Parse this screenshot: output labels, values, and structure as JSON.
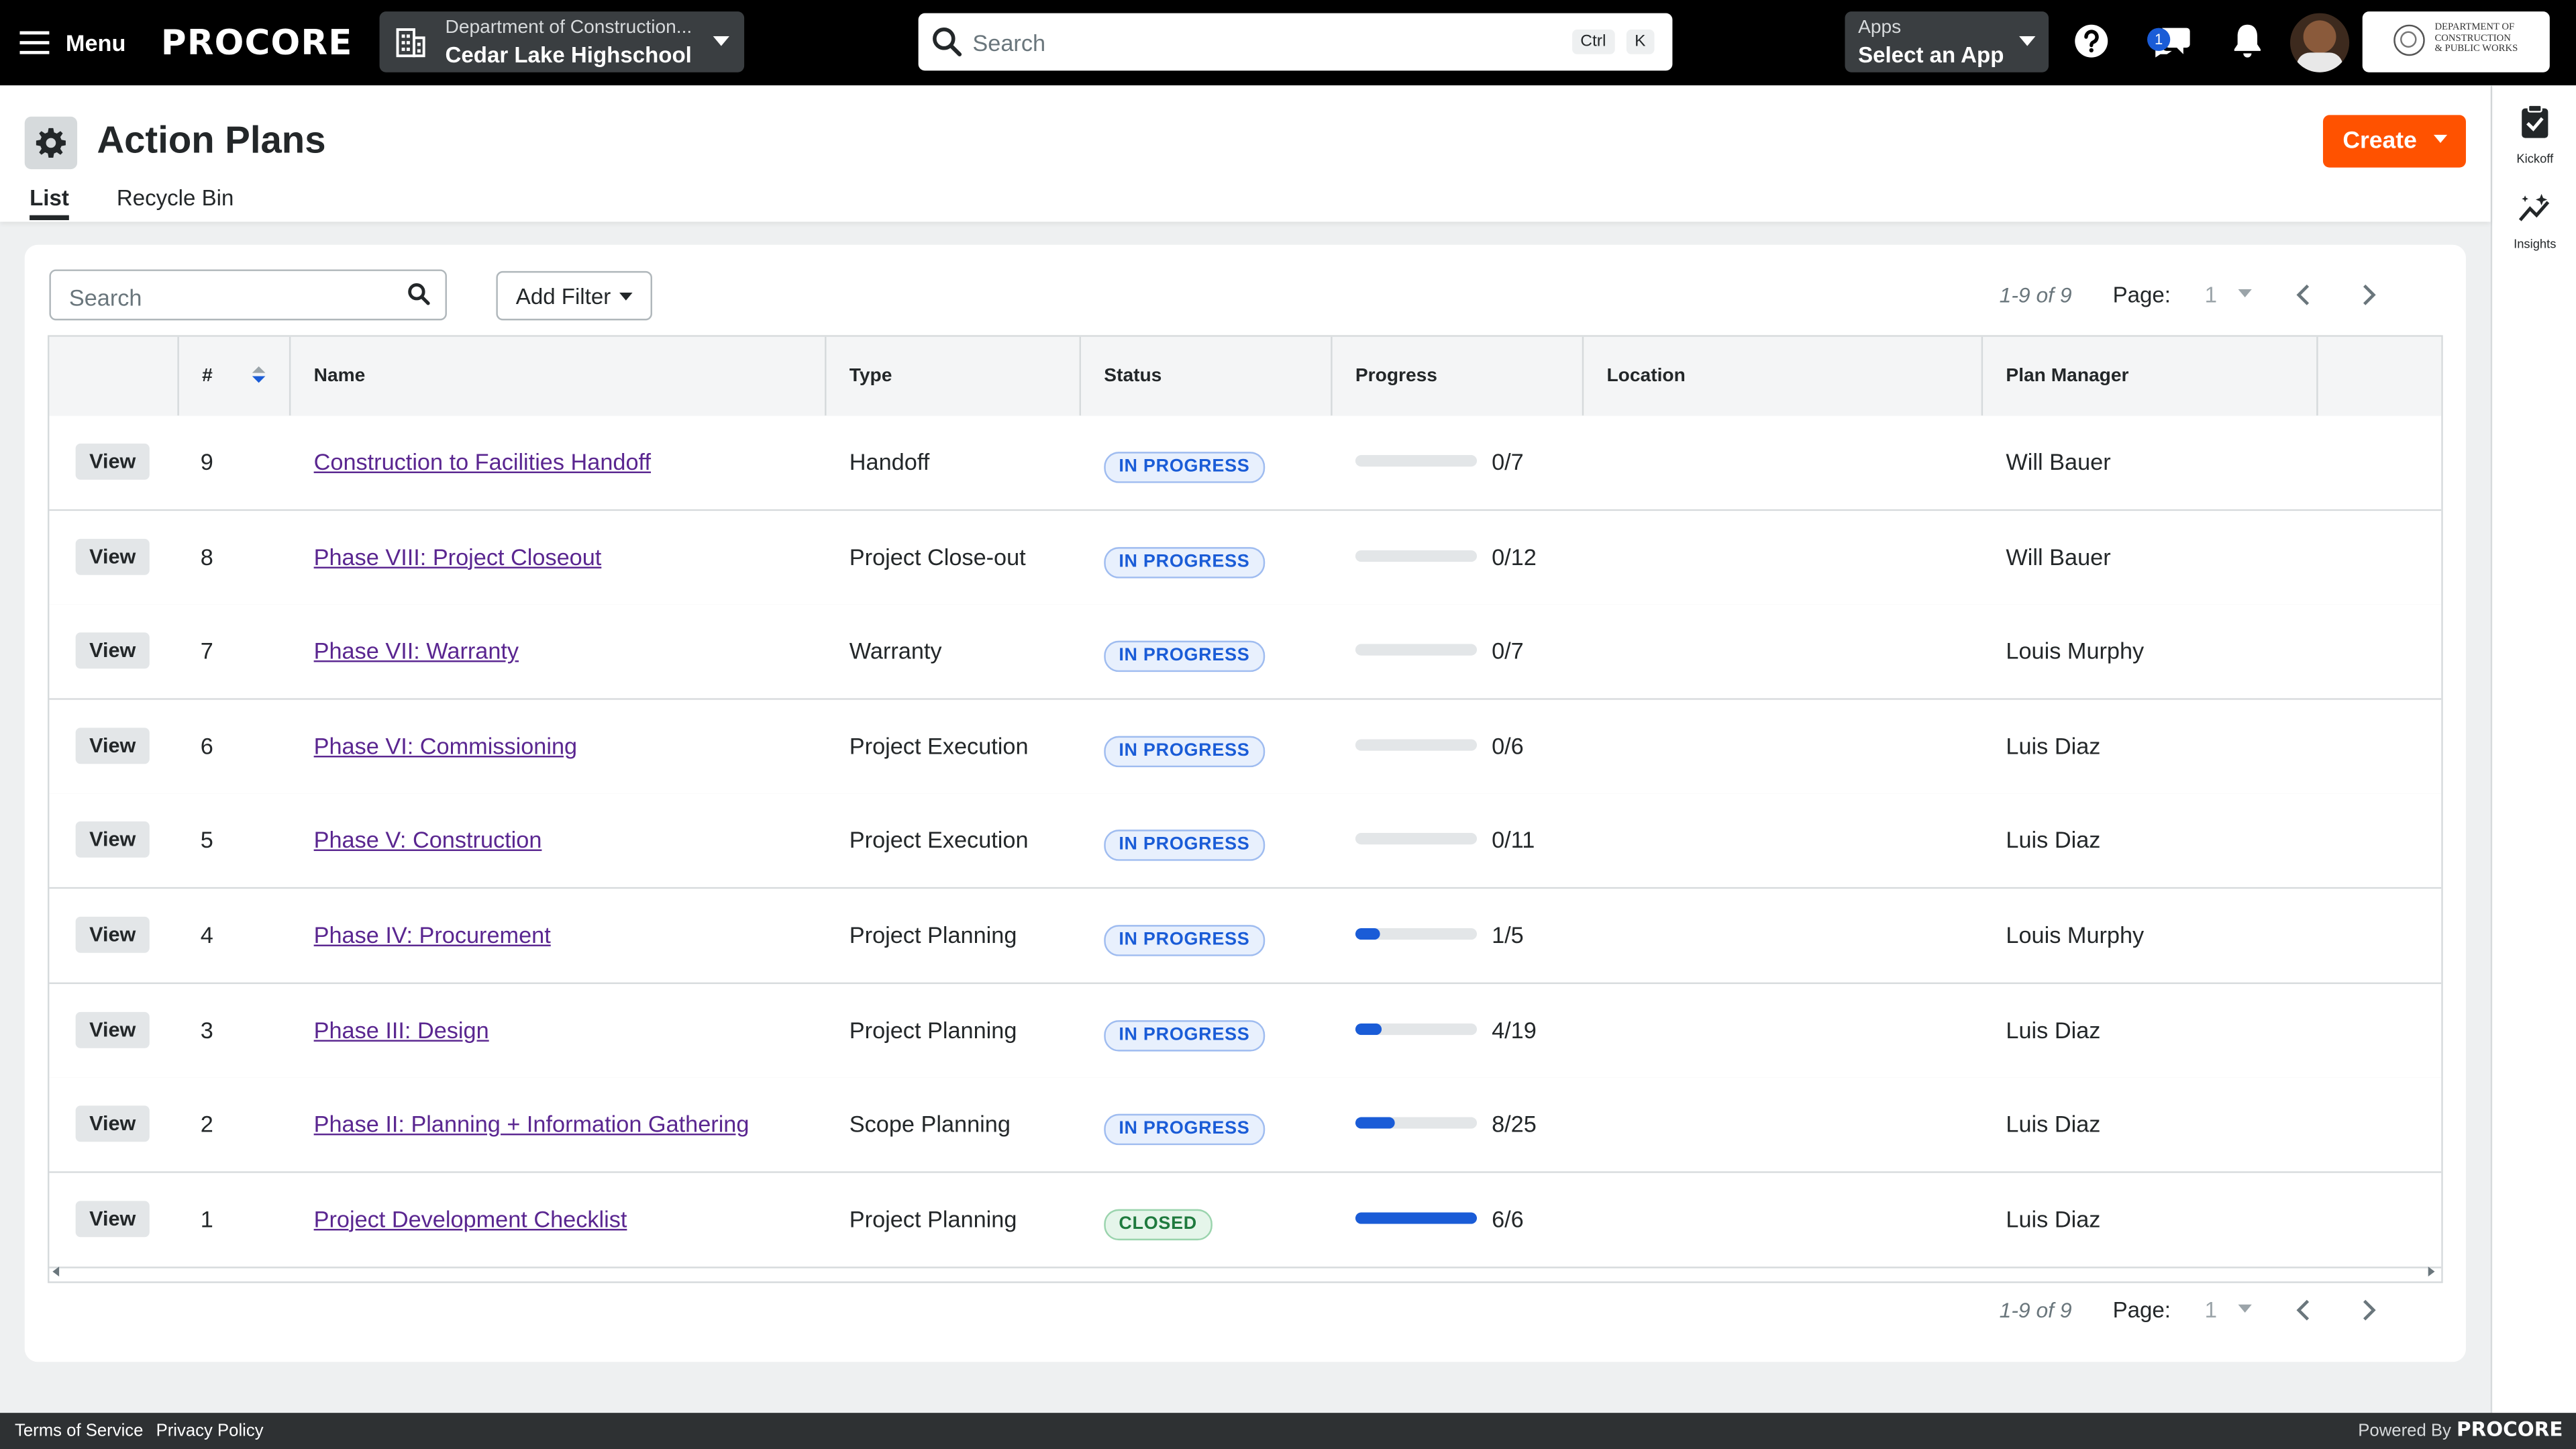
{
  "topbar": {
    "menu_label": "Menu",
    "logo_text": "PROCORE",
    "project_company": "Department of Construction...",
    "project_name": "Cedar Lake Highschool",
    "search_placeholder": "Search",
    "shortcut_ctrl": "Ctrl",
    "shortcut_key": "K",
    "apps_label": "Apps",
    "apps_value": "Select an App",
    "chat_badge": "1",
    "company_logo_lines": [
      "DEPARTMENT OF",
      "CONSTRUCTION",
      "& PUBLIC WORKS"
    ]
  },
  "rail": {
    "items": [
      {
        "label": "Kickoff",
        "icon": "clipboard-check-icon"
      },
      {
        "label": "Insights",
        "icon": "sparkle-chart-icon"
      }
    ]
  },
  "header": {
    "title": "Action Plans",
    "tabs": [
      {
        "label": "List",
        "active": true
      },
      {
        "label": "Recycle Bin",
        "active": false
      }
    ],
    "create_label": "Create"
  },
  "toolbar": {
    "search_placeholder": "Search",
    "add_filter_label": "Add Filter"
  },
  "pagination": {
    "range": "1-9 of 9",
    "page_label": "Page:",
    "page_value": "1"
  },
  "table": {
    "columns": [
      "#",
      "Name",
      "Type",
      "Status",
      "Progress",
      "Location",
      "Plan Manager"
    ],
    "view_label": "View",
    "rows": [
      {
        "num": "9",
        "name": "Construction to Facilities Handoff",
        "type": "Handoff",
        "status": "IN PROGRESS",
        "progress": "0/7",
        "progress_fraction": 0.0,
        "location": "",
        "manager": "Will Bauer"
      },
      {
        "num": "8",
        "name": "Phase VIII: Project Closeout",
        "type": "Project Close-out",
        "status": "IN PROGRESS",
        "progress": "0/12",
        "progress_fraction": 0.0,
        "location": "",
        "manager": "Will Bauer"
      },
      {
        "num": "7",
        "name": "Phase VII: Warranty",
        "type": "Warranty",
        "status": "IN PROGRESS",
        "progress": "0/7",
        "progress_fraction": 0.0,
        "location": "",
        "manager": "Louis Murphy"
      },
      {
        "num": "6",
        "name": "Phase VI: Commissioning",
        "type": "Project Execution",
        "status": "IN PROGRESS",
        "progress": "0/6",
        "progress_fraction": 0.0,
        "location": "",
        "manager": "Luis Diaz"
      },
      {
        "num": "5",
        "name": "Phase V: Construction",
        "type": "Project Execution",
        "status": "IN PROGRESS",
        "progress": "0/11",
        "progress_fraction": 0.0,
        "location": "",
        "manager": "Luis Diaz"
      },
      {
        "num": "4",
        "name": "Phase IV: Procurement",
        "type": "Project Planning",
        "status": "IN PROGRESS",
        "progress": "1/5",
        "progress_fraction": 0.2,
        "location": "",
        "manager": "Louis Murphy"
      },
      {
        "num": "3",
        "name": "Phase III: Design",
        "type": "Project Planning",
        "status": "IN PROGRESS",
        "progress": "4/19",
        "progress_fraction": 0.21,
        "location": "",
        "manager": "Luis Diaz"
      },
      {
        "num": "2",
        "name": "Phase II: Planning + Information Gathering",
        "type": "Scope Planning",
        "status": "IN PROGRESS",
        "progress": "8/25",
        "progress_fraction": 0.32,
        "location": "",
        "manager": "Luis Diaz"
      },
      {
        "num": "1",
        "name": "Project Development Checklist",
        "type": "Project Planning",
        "status": "CLOSED",
        "progress": "6/6",
        "progress_fraction": 1.0,
        "location": "",
        "manager": "Luis Diaz"
      }
    ]
  },
  "footer": {
    "terms": "Terms of Service",
    "privacy": "Privacy Policy",
    "powered_by": "Powered By",
    "logo_text": "PROCORE"
  },
  "colors": {
    "accent": "#ff5200",
    "link": "#5a2690",
    "progress": "#1a5cd7",
    "topbar": "#000000"
  }
}
